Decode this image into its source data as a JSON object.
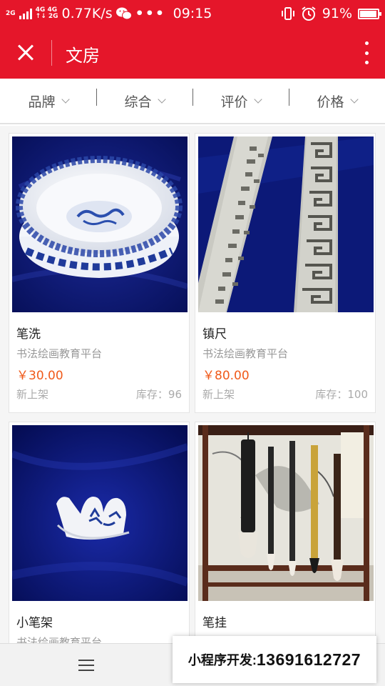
{
  "status_bar": {
    "network_left": "2G",
    "network_mid_top": "4G 4G",
    "network_mid_bottom": "↑↓ 2G",
    "speed": "0.77K/s",
    "time": "09:15",
    "battery": "91%",
    "icons": [
      "signal-icon",
      "wechat-icon",
      "more-dots-icon",
      "vibrate-icon",
      "alarm-icon",
      "battery-icon"
    ]
  },
  "title_bar": {
    "title": "文房"
  },
  "filters": [
    {
      "label": "品牌"
    },
    {
      "label": "综合"
    },
    {
      "label": "评价"
    },
    {
      "label": "价格"
    }
  ],
  "products": [
    {
      "name": "笔洗",
      "store": "书法绘画教育平台",
      "price": "￥30.00",
      "tag": "新上架",
      "stock": "库存：96",
      "image": "blue-white-porcelain-brush-washer"
    },
    {
      "name": "镇尺",
      "store": "书法绘画教育平台",
      "price": "￥80.00",
      "tag": "新上架",
      "stock": "库存：100",
      "image": "engraved-metal-paperweights"
    },
    {
      "name": "小笔架",
      "store": "书法绘画教育平台",
      "price": "",
      "tag": "",
      "stock": "",
      "image": "porcelain-brush-rest"
    },
    {
      "name": "笔挂",
      "store": "",
      "price": "",
      "tag": "",
      "stock": "",
      "image": "hanging-brush-rack"
    }
  ],
  "contact": {
    "label": "小程序开发:",
    "phone": "13691612727"
  },
  "colors": {
    "brand_red": "#e5162a",
    "price_orange": "#f05a1a"
  }
}
